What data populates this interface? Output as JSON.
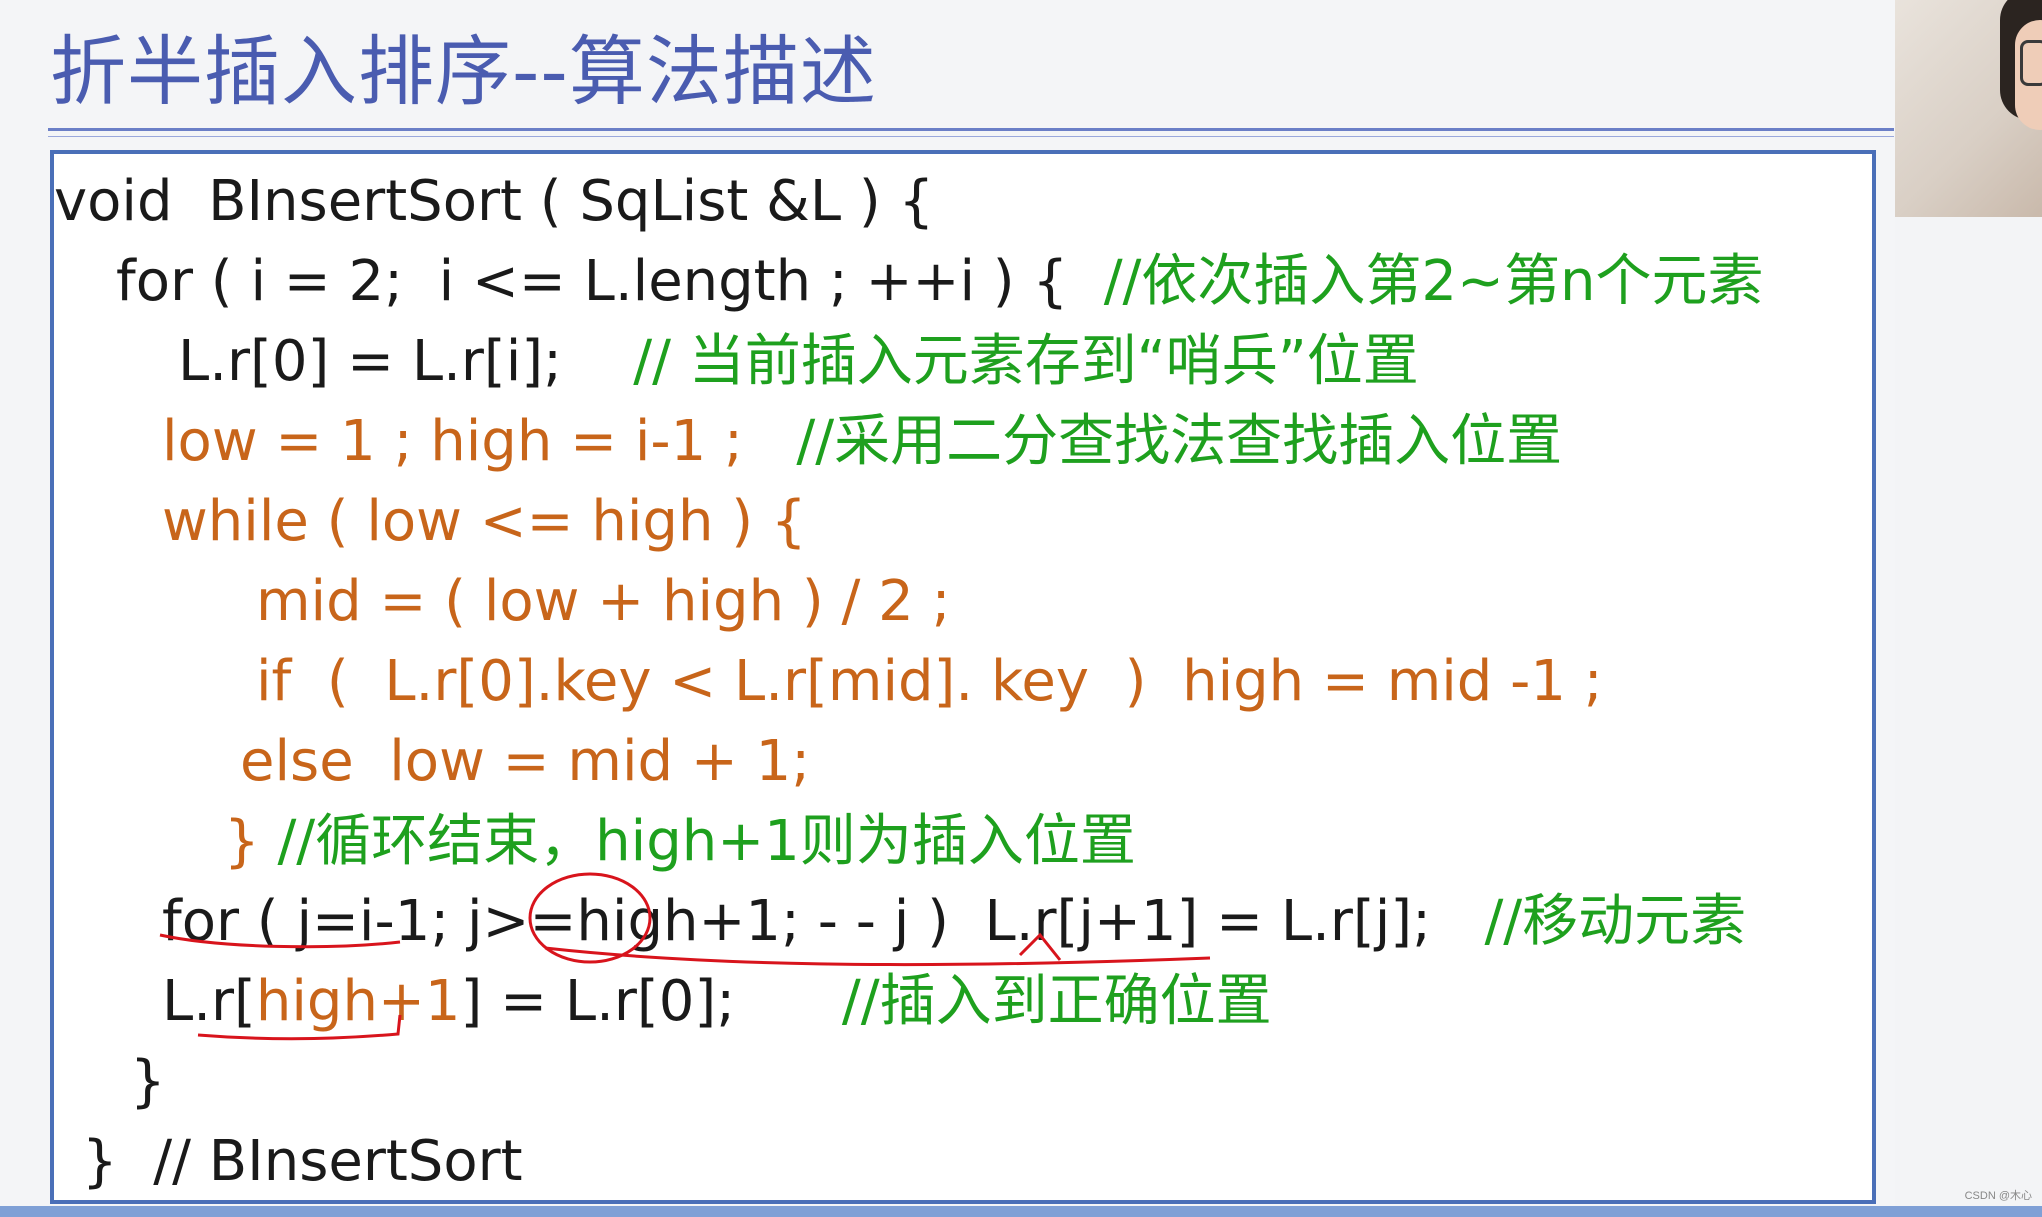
{
  "slide": {
    "title": "折半插入排序--算法描述",
    "code_lines": [
      {
        "segments": [
          {
            "text": "void  BInsertSort ( SqList &L ) {",
            "color": "black"
          }
        ]
      },
      {
        "segments": [
          {
            "text": "for ( i = 2;  i <= L.length ; ++i ) {  ",
            "color": "black"
          },
          {
            "text": "//依次插入第2~第n个元素",
            "color": "green"
          }
        ]
      },
      {
        "segments": [
          {
            "text": "L.r[0] = L.r[i];    ",
            "color": "black"
          },
          {
            "text": "// 当前插入元素存到“哨兵”位置",
            "color": "green"
          }
        ]
      },
      {
        "segments": [
          {
            "text": "low = 1 ; high = i-1 ;   ",
            "color": "orange"
          },
          {
            "text": "//采用二分查找法查找插入位置",
            "color": "green"
          }
        ]
      },
      {
        "segments": [
          {
            "text": "while ( low <= high ) {",
            "color": "orange"
          }
        ]
      },
      {
        "segments": [
          {
            "text": "mid = ( low + high ) / 2 ;",
            "color": "orange"
          }
        ]
      },
      {
        "segments": [
          {
            "text": "if  (  L.r[0].key < L.r[mid]. key  )  high = mid -1 ;",
            "color": "orange"
          }
        ]
      },
      {
        "segments": [
          {
            "text": "else  low = mid + 1;",
            "color": "orange"
          }
        ]
      },
      {
        "segments": [
          {
            "text": "} ",
            "color": "orange"
          },
          {
            "text": "//循环结束，high+1则为插入位置",
            "color": "green"
          }
        ]
      },
      {
        "segments": [
          {
            "text": "for ( j=i-1; j>=high+1; - - j )  L.r[j+1] = L.r[j];   ",
            "color": "black"
          },
          {
            "text": "//移动元素",
            "color": "green"
          }
        ]
      },
      {
        "segments": [
          {
            "text": "L.r[",
            "color": "black"
          },
          {
            "text": "high+1",
            "color": "orange"
          },
          {
            "text": "] = L.r[0];      ",
            "color": "black"
          },
          {
            "text": "//插入到正确位置",
            "color": "green"
          }
        ]
      },
      {
        "segments": [
          {
            "text": "}",
            "color": "black"
          }
        ]
      },
      {
        "segments": [
          {
            "text": "}  // BInsertSort",
            "color": "black"
          }
        ]
      }
    ]
  },
  "watermark": "CSDN @木心",
  "colors": {
    "black": "#1a1a1a",
    "orange": "#c8651a",
    "green": "#1ea01e",
    "title": "#4a5cb0",
    "ink": "#d8141c"
  }
}
